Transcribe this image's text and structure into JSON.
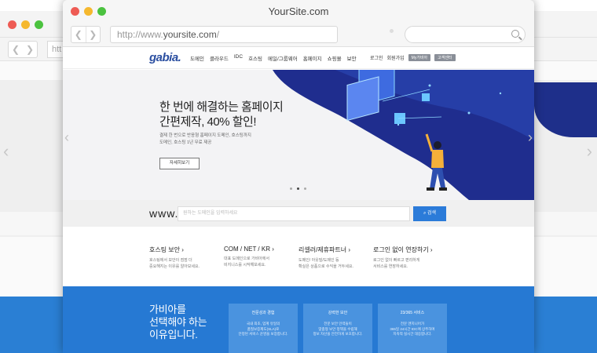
{
  "background_window": {
    "url_partial": "htt"
  },
  "browser": {
    "title": "YourSite.com",
    "url_prefix": "http://www.",
    "url_domain": "yoursite.com",
    "url_suffix": "/",
    "nav_back": "❮",
    "nav_forward": "❯",
    "search_icon": "search-icon"
  },
  "site": {
    "logo": "gabia.",
    "gnb": [
      "도메인",
      "클라우드",
      "IDC",
      "호스팅",
      "메일/그룹웨어",
      "홈페이지",
      "쇼핑몰",
      "보안"
    ],
    "util": {
      "login": "로그인",
      "signup": "회원가입",
      "mypage": "My가비아",
      "support": "고객센터"
    }
  },
  "hero": {
    "title_line1": "한 번에 해결하는 홈페이지",
    "title_line2": "간편제작, 40% 할인!",
    "desc_line1": "결제 한 번으로 반응형 홈페이지 도메인, 호스팅까지",
    "desc_line2": "도메인, 호스팅 1년 무료 제공",
    "button": "자세히보기",
    "prev": "‹",
    "next": "›"
  },
  "domain_search": {
    "prefix": "www.",
    "placeholder": "원하는 도메인을 입력하세요",
    "button": "검색"
  },
  "services": [
    {
      "title": "호스팅 보안 ›",
      "desc1": "호스팅에서 보안이 점점 더",
      "desc2": "중요해지는 이유를 알아보세요."
    },
    {
      "title": "COM / NET / KR ›",
      "desc1": "대표 도메인으로 가비아에서",
      "desc2": "비지니스를 시작해보세요."
    },
    {
      "title": "리셀러/제휴파트너 ›",
      "desc1": "도메인/ 아웃빌/도메인 등",
      "desc2": "확실은 상품으로 수익을 거두세요."
    },
    {
      "title": "로그인 없이 연장하기 ›",
      "desc1": "로그인 없이 빠르고 편리하게",
      "desc2": "서비스를 연장하세요."
    }
  ],
  "why": {
    "line1": "가비아를",
    "line2": "선택해야 하는",
    "line3": "이유입니다.",
    "cards": [
      {
        "title": "전문성과 경험",
        "d1": "국내 최초, 업계 유일의",
        "d2": "품질보증제도(SLA)로",
        "d3": "안정된 서비스 운영을 보장합니다."
      },
      {
        "title": "강력한 보안",
        "d1": "전문 보안 인력들이",
        "d2": "맞춤형 보안 정책을 수립해",
        "d3": "정보 자산을 안전하게 보호합니다."
      },
      {
        "title": "23/365 서비스",
        "d1": "전문 엔지니어가",
        "d2": "365일 24시간 IDC에 상주하며",
        "d3": "지속적 실시간 대응합니다."
      }
    ]
  },
  "colors": {
    "accent": "#2b7bd9",
    "why_bg": "#2679d3",
    "hero_blob": "#1e2f8a",
    "logo": "#2a4ea0"
  }
}
